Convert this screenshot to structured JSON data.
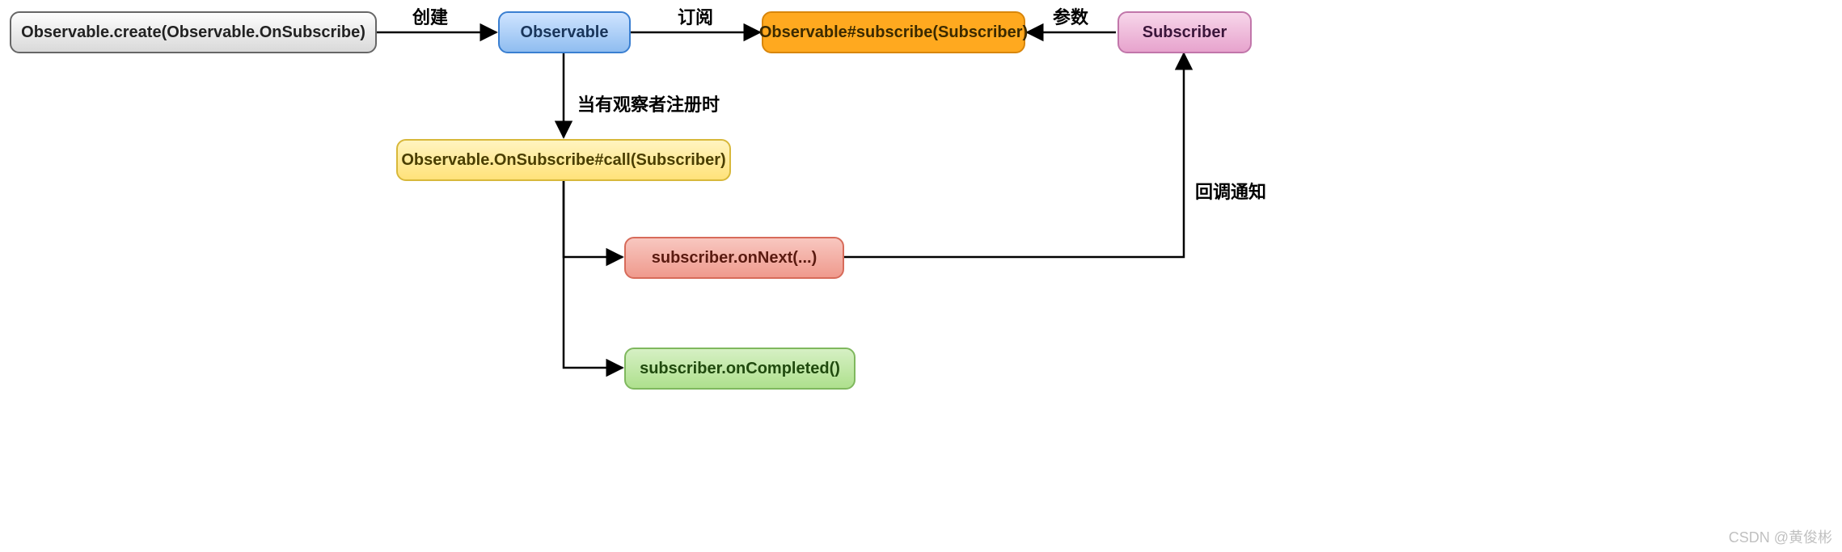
{
  "nodes": {
    "create": "Observable.create(Observable.OnSubscribe)",
    "observable": "Observable",
    "subscribe": "Observable#subscribe(Subscriber)",
    "subscriber": "Subscriber",
    "call": "Observable.OnSubscribe#call(Subscriber)",
    "onNext": "subscriber.onNext(...)",
    "onCompleted": "subscriber.onCompleted()"
  },
  "labels": {
    "create": "创建",
    "subscribe": "订阅",
    "param": "参数",
    "register": "当有观察者注册时",
    "callback": "回调通知"
  },
  "watermark": "CSDN @黄俊彬"
}
